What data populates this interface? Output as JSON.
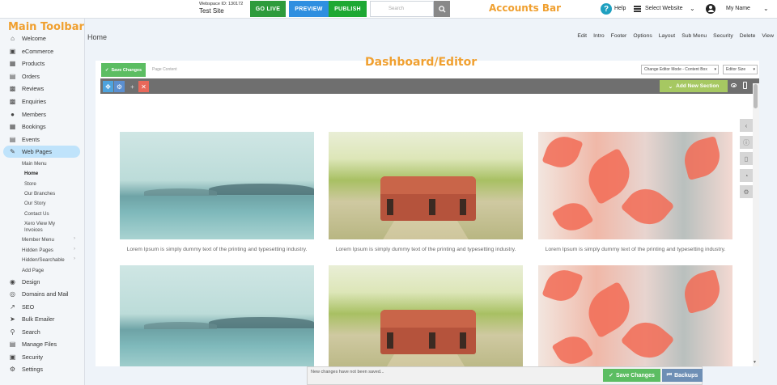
{
  "account_bar": {
    "webspace_id_label": "Webspace ID: 130172",
    "site_name": "Test Site",
    "go_live": "GO LIVE",
    "preview": "PREVIEW",
    "publish": "PUBLISH",
    "search_placeholder": "Search",
    "help": "Help",
    "select_website": "Select Website",
    "user_name": "My Name"
  },
  "callouts": {
    "main_toolbar": "Main Toolbar",
    "accounts_bar": "Accounts Bar",
    "dashboard_editor": "Dashboard/Editor"
  },
  "sidebar": {
    "items": [
      {
        "label": "Welcome",
        "icon": "home-icon"
      },
      {
        "label": "eCommerce",
        "icon": "cart-icon"
      },
      {
        "label": "Products",
        "icon": "products-icon"
      },
      {
        "label": "Orders",
        "icon": "orders-icon"
      },
      {
        "label": "Reviews",
        "icon": "reviews-icon"
      },
      {
        "label": "Enquiries",
        "icon": "enquiries-icon"
      },
      {
        "label": "Members",
        "icon": "members-icon"
      },
      {
        "label": "Bookings",
        "icon": "calendar-icon"
      },
      {
        "label": "Events",
        "icon": "events-icon"
      },
      {
        "label": "Web Pages",
        "icon": "pencil-icon"
      },
      {
        "label": "Design",
        "icon": "palette-icon"
      },
      {
        "label": "Domains and Mail",
        "icon": "globe-icon"
      },
      {
        "label": "SEO",
        "icon": "trend-icon"
      },
      {
        "label": "Bulk Emailer",
        "icon": "send-icon"
      },
      {
        "label": "Search",
        "icon": "search-icon"
      },
      {
        "label": "Manage Files",
        "icon": "folder-icon"
      },
      {
        "label": "Security",
        "icon": "lock-icon"
      },
      {
        "label": "Settings",
        "icon": "gear-icon"
      }
    ],
    "web_pages_sub": {
      "main_menu": "Main Menu",
      "pages": [
        "Home",
        "Store",
        "Our Branches",
        "Our Story",
        "Contact Us",
        "Xero View My",
        "Invoices"
      ],
      "member_menu": "Member Menu",
      "hidden_pages": "Hidden Pages",
      "hidden_searchable": "Hidden/Searchable",
      "add_page": "Add Page"
    }
  },
  "main": {
    "page_title": "Home",
    "top_links": [
      "Edit",
      "Intro",
      "Footer",
      "Options",
      "Layout",
      "Sub Menu",
      "Security",
      "Delete",
      "View"
    ]
  },
  "editor": {
    "save_changes": "Save Changes",
    "page_content_label": "Page Content",
    "mode_select": "Change Editor Mode - Content Box",
    "size_select": "Editor Size",
    "add_new_section": "Add New Section",
    "captions": [
      "Lorem Ipsum is simply dummy text of the printing and typesetting industry.",
      "Lorem Ipsum is simply dummy text of the printing and typesetting industry.",
      "Lorem Ipsum is simply dummy text of the printing and typesetting industry."
    ]
  },
  "bottom_bar": {
    "message": "New changes have not been saved...",
    "save_changes": "Save Changes",
    "backups": "Backups"
  },
  "colors": {
    "go_live": "#2e9b3c",
    "preview": "#2f8fe0",
    "publish": "#1ea833",
    "callout": "#f0a030",
    "active_nav": "#bfe3fb",
    "save": "#5cbd62",
    "add_section": "#a6c862",
    "backups": "#6e8fb5"
  }
}
